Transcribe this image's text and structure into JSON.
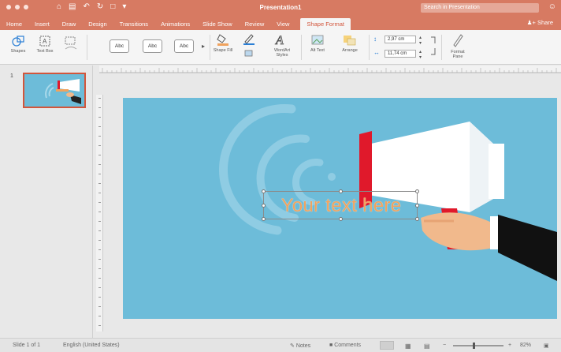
{
  "window": {
    "title": "Presentation1",
    "search_placeholder": "Search in Presentation",
    "share_label": "Share"
  },
  "tabs": [
    "Home",
    "Insert",
    "Draw",
    "Design",
    "Transitions",
    "Animations",
    "Slide Show",
    "Review",
    "View",
    "Shape Format"
  ],
  "ribbon": {
    "shapes_label": "Shapes",
    "text_box_label": "Text Box",
    "style_labels": [
      "Abc",
      "Abc",
      "Abc"
    ],
    "shape_fill_label": "Shape Fill",
    "wordart_label": "WordArt Styles",
    "alt_text_label": "Alt Text",
    "arrange_label": "Arrange",
    "height_value": "2,97 cm",
    "width_value": "11,74 cm",
    "format_pane_label": "Format Pane"
  },
  "thumbnails": {
    "slide_number": "1"
  },
  "slide": {
    "textbox_text": "Your text here"
  },
  "statusbar": {
    "slide_info": "Slide 1 of 1",
    "language": "English (United States)",
    "notes_label": "Notes",
    "comments_label": "Comments",
    "zoom": "82%"
  },
  "colors": {
    "accent": "#d77a62",
    "slide_bg": "#6dbcd9",
    "megaphone_red": "#e0192b"
  }
}
